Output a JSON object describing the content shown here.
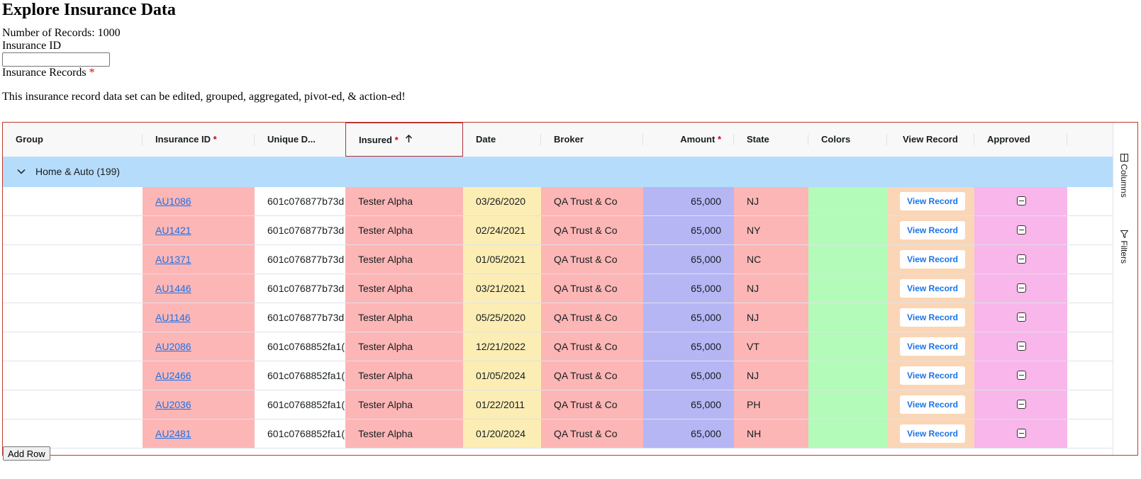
{
  "page": {
    "title": "Explore Insurance Data",
    "records_label": "Number of Records: 1000",
    "id_label": "Insurance ID",
    "id_value": "",
    "records_field_label": "Insurance Records",
    "required_mark": "*",
    "description": "This insurance record data set can be edited, grouped, aggregated, pivot-ed, & action-ed!",
    "add_row_label": "Add Row"
  },
  "grid": {
    "columns": {
      "group": "Group",
      "insurance_id": "Insurance ID",
      "unique_d": "Unique D...",
      "insured": "Insured",
      "date": "Date",
      "broker": "Broker",
      "amount": "Amount",
      "state": "State",
      "colors": "Colors",
      "view_record": "View Record",
      "approved": "Approved"
    },
    "sort_icon": "arrow-up-icon",
    "group_row": {
      "label": "Home & Auto (199)",
      "icon": "chevron-down-icon"
    },
    "rows": [
      {
        "id": "AU1086",
        "uid": "601c076877b73d",
        "insured": "Tester Alpha",
        "date": "03/26/2020",
        "broker": "QA Trust & Co",
        "amount": "65,000",
        "state": "NJ",
        "btn": "View Record"
      },
      {
        "id": "AU1421",
        "uid": "601c076877b73d",
        "insured": "Tester Alpha",
        "date": "02/24/2021",
        "broker": "QA Trust & Co",
        "amount": "65,000",
        "state": "NY",
        "btn": "View Record"
      },
      {
        "id": "AU1371",
        "uid": "601c076877b73d",
        "insured": "Tester Alpha",
        "date": "01/05/2021",
        "broker": "QA Trust & Co",
        "amount": "65,000",
        "state": "NC",
        "btn": "View Record"
      },
      {
        "id": "AU1446",
        "uid": "601c076877b73d",
        "insured": "Tester Alpha",
        "date": "03/21/2021",
        "broker": "QA Trust & Co",
        "amount": "65,000",
        "state": "NJ",
        "btn": "View Record"
      },
      {
        "id": "AU1146",
        "uid": "601c076877b73d",
        "insured": "Tester Alpha",
        "date": "05/25/2020",
        "broker": "QA Trust & Co",
        "amount": "65,000",
        "state": "NJ",
        "btn": "View Record"
      },
      {
        "id": "AU2086",
        "uid": "601c0768852fa1(",
        "insured": "Tester Alpha",
        "date": "12/21/2022",
        "broker": "QA Trust & Co",
        "amount": "65,000",
        "state": "VT",
        "btn": "View Record"
      },
      {
        "id": "AU2466",
        "uid": "601c0768852fa1(",
        "insured": "Tester Alpha",
        "date": "01/05/2024",
        "broker": "QA Trust & Co",
        "amount": "65,000",
        "state": "NJ",
        "btn": "View Record"
      },
      {
        "id": "AU2036",
        "uid": "601c0768852fa1(",
        "insured": "Tester Alpha",
        "date": "01/22/2011",
        "broker": "QA Trust & Co",
        "amount": "65,000",
        "state": "PH",
        "btn": "View Record"
      },
      {
        "id": "AU2481",
        "uid": "601c0768852fa1(",
        "insured": "Tester Alpha",
        "date": "01/20/2024",
        "broker": "QA Trust & Co",
        "amount": "65,000",
        "state": "NH",
        "btn": "View Record"
      }
    ],
    "side_panel": {
      "columns_label": "Columns",
      "filters_label": "Filters",
      "columns_icon": "columns-icon",
      "filters_icon": "filter-icon"
    }
  },
  "colors": {
    "grid_border": "#c0392b",
    "group_row": "#b6dcfb",
    "red_cell": "#fdb6b6",
    "yellow_cell": "#fcedb4",
    "blue_cell": "#b6b6f5",
    "green_cell": "#b2fbb8",
    "peach_cell": "#fbd6b6",
    "pink_cell": "#f8b6ea",
    "link": "#1a73e8"
  }
}
